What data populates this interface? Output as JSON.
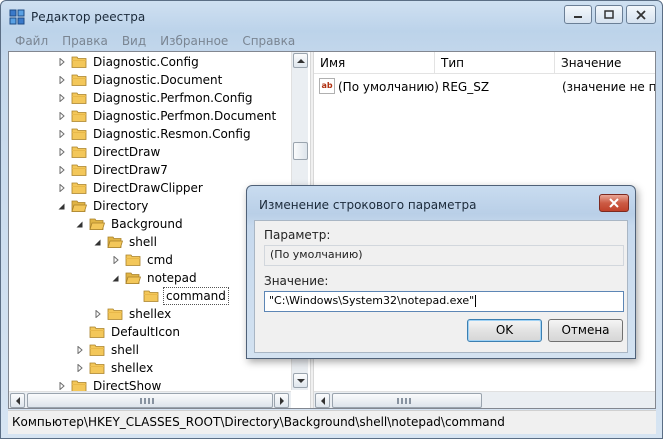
{
  "window": {
    "title": "Редактор реестра"
  },
  "menu": [
    "Файл",
    "Правка",
    "Вид",
    "Избранное",
    "Справка"
  ],
  "tree": [
    {
      "label": "Diagnostic.Config",
      "state": "collapsed"
    },
    {
      "label": "Diagnostic.Document",
      "state": "collapsed"
    },
    {
      "label": "Diagnostic.Perfmon.Config",
      "state": "collapsed"
    },
    {
      "label": "Diagnostic.Perfmon.Document",
      "state": "collapsed"
    },
    {
      "label": "Diagnostic.Resmon.Config",
      "state": "collapsed"
    },
    {
      "label": "DirectDraw",
      "state": "collapsed"
    },
    {
      "label": "DirectDraw7",
      "state": "collapsed"
    },
    {
      "label": "DirectDrawClipper",
      "state": "collapsed"
    },
    {
      "label": "Directory",
      "state": "expanded"
    },
    {
      "label": "Background",
      "state": "expanded"
    },
    {
      "label": "shell",
      "state": "expanded"
    },
    {
      "label": "cmd",
      "state": "collapsed"
    },
    {
      "label": "notepad",
      "state": "expanded"
    },
    {
      "label": "command",
      "state": "none"
    },
    {
      "label": "shellex",
      "state": "collapsed"
    },
    {
      "label": "DefaultIcon",
      "state": "none"
    },
    {
      "label": "shell",
      "state": "collapsed"
    },
    {
      "label": "shellex",
      "state": "collapsed"
    },
    {
      "label": "DirectShow",
      "state": "collapsed"
    }
  ],
  "values_pane": {
    "columns": [
      "Имя",
      "Тип",
      "Значение"
    ],
    "rows": [
      {
        "icon": "string-value-icon",
        "icon_text": "ab",
        "name": "(По умолчанию)",
        "type": "REG_SZ",
        "value": "(значение не при"
      }
    ]
  },
  "status": "Компьютер\\HKEY_CLASSES_ROOT\\Directory\\Background\\shell\\notepad\\command",
  "dialog": {
    "title": "Изменение строкового параметра",
    "param_label": "Параметр:",
    "param_value": "(По умолчанию)",
    "value_label": "Значение:",
    "value_text": "\"C:\\Windows\\System32\\notepad.exe\"",
    "ok": "OK",
    "cancel": "Отмена"
  },
  "colors": {
    "folder": "#f3c75a",
    "title_bg": "#c5d8ec",
    "close_red": "#c0412a"
  }
}
